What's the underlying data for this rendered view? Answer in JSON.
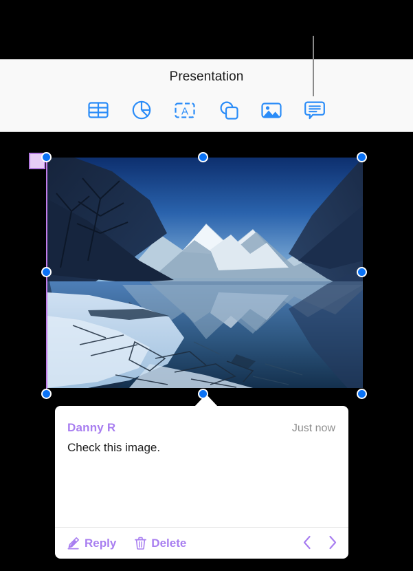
{
  "window": {
    "title": "Presentation"
  },
  "colors": {
    "accent_blue": "#0a72f5",
    "comment_purple": "#a87ef0",
    "flag_fill": "#e7cdf5",
    "flag_border": "#b57ce0",
    "selection_edge": "#c07ce8",
    "toolbar_bg": "#f9f9f9",
    "callout_line": "#8a8a8a"
  },
  "toolbar": {
    "items": [
      {
        "icon": "table-icon",
        "label": "Table"
      },
      {
        "icon": "chart-icon",
        "label": "Chart"
      },
      {
        "icon": "text-box-icon",
        "label": "Text"
      },
      {
        "icon": "shapes-icon",
        "label": "Shape"
      },
      {
        "icon": "media-icon",
        "label": "Media"
      },
      {
        "icon": "comment-icon",
        "label": "Comment"
      }
    ]
  },
  "canvas": {
    "image": {
      "icon": "photo-mountain-lake",
      "alt": "Winter mountain lake with reflection"
    },
    "comment_marker": {
      "icon": "comment-flag-icon"
    },
    "handles": [
      "top-left",
      "top-center",
      "top-right",
      "middle-left",
      "middle-right",
      "bottom-left",
      "bottom-center",
      "bottom-right"
    ]
  },
  "comment_popup": {
    "author": "Danny R",
    "timestamp": "Just now",
    "body": "Check this image.",
    "actions": {
      "reply": {
        "label": "Reply",
        "icon": "pencil-icon"
      },
      "delete": {
        "label": "Delete",
        "icon": "trash-icon"
      }
    },
    "navigation": {
      "previous": {
        "icon": "chevron-left-icon"
      },
      "next": {
        "icon": "chevron-right-icon"
      }
    }
  }
}
